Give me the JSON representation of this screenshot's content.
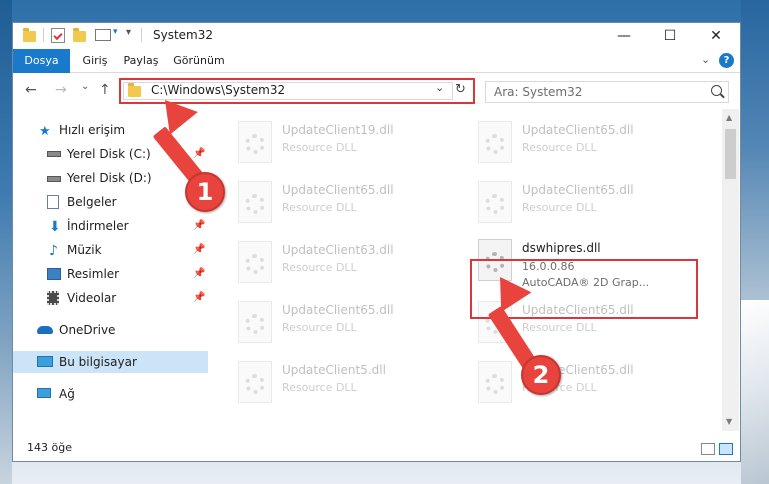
{
  "window": {
    "title": "System32",
    "minimize_glyph": "—",
    "maximize_glyph": "☐",
    "close_glyph": "✕"
  },
  "ribbon": {
    "tabs": [
      {
        "label": "Dosya"
      },
      {
        "label": "Giriş"
      },
      {
        "label": "Paylaş"
      },
      {
        "label": "Görünüm"
      }
    ],
    "expand_glyph": "⌄",
    "help_glyph": "?"
  },
  "nav": {
    "back_glyph": "←",
    "forward_glyph": "→",
    "recent_glyph": "⌄",
    "up_glyph": "↑",
    "address": "C:\\Windows\\System32",
    "address_dropdown_glyph": "⌄",
    "refresh_glyph": "↻",
    "search_placeholder": "Ara: System32"
  },
  "sidebar": {
    "items": [
      {
        "label": "Hızlı erişim",
        "icon": "star-icon"
      },
      {
        "label": "Yerel Disk (C:)",
        "icon": "drive-icon",
        "pinned": true
      },
      {
        "label": "Yerel Disk (D:)",
        "icon": "drive-icon"
      },
      {
        "label": "Belgeler",
        "icon": "document-icon",
        "pinned": true
      },
      {
        "label": "İndirmeler",
        "icon": "download-icon",
        "pinned": true
      },
      {
        "label": "Müzik",
        "icon": "music-icon",
        "pinned": true
      },
      {
        "label": "Resimler",
        "icon": "pictures-icon",
        "pinned": true
      },
      {
        "label": "Videolar",
        "icon": "video-icon",
        "pinned": true
      },
      {
        "label": "OneDrive",
        "icon": "cloud-icon"
      },
      {
        "label": "Bu bilgisayar",
        "icon": "computer-icon",
        "selected": true
      },
      {
        "label": "Ağ",
        "icon": "network-icon"
      }
    ],
    "pin_glyph": "📌"
  },
  "files": [
    {
      "name": "UpdateClient19.dll",
      "sub": "Resource DLL",
      "faded": true
    },
    {
      "name": "UpdateClient65.dll",
      "sub": "Resource DLL",
      "faded": true
    },
    {
      "name": "UpdateClient65.dll",
      "sub": "Resource DLL",
      "faded": true
    },
    {
      "name": "UpdateClient65.dll",
      "sub": "Resource DLL",
      "faded": true
    },
    {
      "name": "UpdateClient63.dll",
      "sub": "Resource DLL",
      "faded": true
    },
    {
      "name": "dswhipres.dll",
      "sub": "16.0.0.86",
      "sub2": "AutoCADA® 2D Grap...",
      "faded": false
    },
    {
      "name": "UpdateClient65.dll",
      "sub": "Resource DLL",
      "faded": true
    },
    {
      "name": "UpdateClient65.dll",
      "sub": "Resource DLL",
      "faded": true
    },
    {
      "name": "UpdateClient5.dll",
      "sub": "Resource DLL",
      "faded": true
    },
    {
      "name": "UpdateClient65.dll",
      "sub": "Resource DLL",
      "faded": true
    }
  ],
  "status": {
    "count": "143 öğe"
  },
  "scrollbar": {
    "up_glyph": "▲",
    "down_glyph": "▼"
  },
  "annotations": {
    "step1": "1",
    "step2": "2"
  },
  "colors": {
    "accent": "#1979ca",
    "annotation": "#e8433d",
    "selection": "#cce4f7"
  }
}
